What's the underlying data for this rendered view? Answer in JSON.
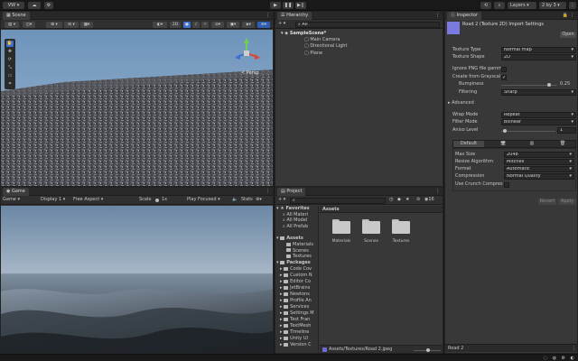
{
  "topbar": {
    "account": "VW",
    "layers": "Layers",
    "layout": "2 by 3"
  },
  "scene": {
    "tab": "Scene",
    "mode_2d": "2D",
    "persp": "< Persp"
  },
  "game": {
    "tab": "Game",
    "display_mode": "Game",
    "display": "Display 1",
    "aspect": "Free Aspect",
    "scale_label": "Scale",
    "scale_value": "1x",
    "play_mode": "Play Focused",
    "stats": "Stats"
  },
  "hierarchy": {
    "tab": "Hierarchy",
    "add": "+",
    "search_placeholder": "All",
    "scene_name": "SampleScene*",
    "items": [
      "Main Camera",
      "Directional Light",
      "Plane"
    ]
  },
  "project": {
    "tab": "Project",
    "add": "+",
    "favorites_label": "Favorites",
    "favorites": [
      "All Materi",
      "All Model",
      "All Prefab"
    ],
    "assets_label": "Assets",
    "asset_folders": [
      "Materials",
      "Scenes",
      "Textures"
    ],
    "packages_label": "Packages",
    "packages": [
      "Code Cov",
      "Custom N",
      "Editor Co",
      "JetBrains",
      "Newtons",
      "Profile An",
      "Services",
      "Settings M",
      "Test Fran",
      "TextMesh",
      "Timeline",
      "Unity UI",
      "Version C"
    ],
    "breadcrumb": "Assets",
    "grid_items": [
      "Materials",
      "Scenes",
      "Textures"
    ],
    "hidden_count": "16",
    "footer_path": "Assets/Textures/Road 2.jpeg"
  },
  "inspector": {
    "tab": "Inspector",
    "title": "Road 2 (Texture 2D) Import Settings",
    "open_button": "Open",
    "texture_type_label": "Texture Type",
    "texture_type": "Normal map",
    "texture_shape_label": "Texture Shape",
    "texture_shape": "2D",
    "ignore_png": "Ignore PNG file gamm",
    "create_from_grayscale": "Create from Grayscal",
    "bumpiness_label": "Bumpiness",
    "bumpiness": "0.25",
    "bumpiness_fraction": 0.85,
    "filtering_label": "Filtering",
    "filtering": "Sharp",
    "advanced": "Advanced",
    "wrap_mode_label": "Wrap Mode",
    "wrap_mode": "Repeat",
    "filter_mode_label": "Filter Mode",
    "filter_mode": "Bilinear",
    "aniso_label": "Aniso Level",
    "aniso": "1",
    "aniso_fraction": 0.06,
    "platform_default": "Default",
    "max_size_label": "Max Size",
    "max_size": "2048",
    "resize_label": "Resize Algorithm",
    "resize": "Mitchell",
    "format_label": "Format",
    "format": "Automatic",
    "compression_label": "Compression",
    "compression": "Normal Quality",
    "crunch_label": "Use Crunch Compres",
    "revert": "Revert",
    "apply": "Apply",
    "preview_name": "Road 2"
  }
}
